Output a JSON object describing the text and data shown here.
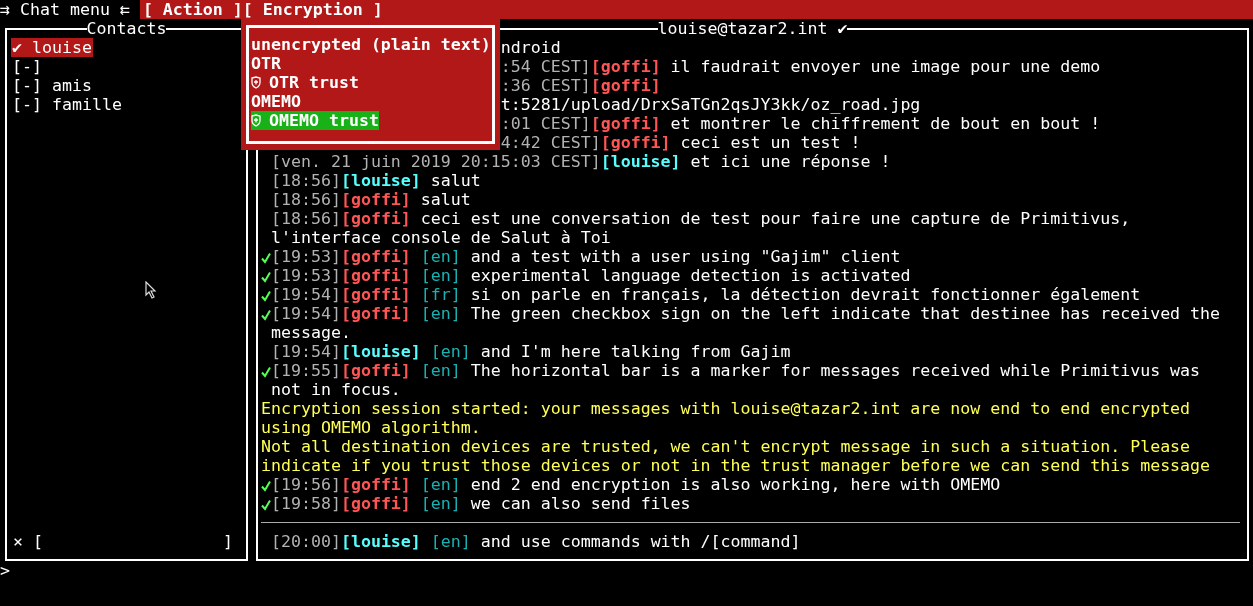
{
  "menu_bar": {
    "title": "⇉ Chat menu ⇇",
    "items": [
      {
        "label": "[ Action ]"
      },
      {
        "label": "[ Encryption ]"
      }
    ]
  },
  "encryption_menu": {
    "items": [
      {
        "label": "unencrypted (plain text)",
        "kind": "plain",
        "selected": false
      },
      {
        "label": "OTR",
        "kind": "plain",
        "selected": false
      },
      {
        "label": "OTR trust",
        "kind": "trust",
        "selected": false
      },
      {
        "label": "OMEMO",
        "kind": "plain",
        "selected": false
      },
      {
        "label": "OMEMO trust",
        "kind": "trust",
        "selected": true
      }
    ]
  },
  "contacts": {
    "title": "Contacts",
    "items": [
      {
        "label": "✔ louise",
        "selected": true
      },
      {
        "label": "[-]",
        "selected": false
      },
      {
        "label": "[-] amis",
        "selected": false
      },
      {
        "label": "[-] famille",
        "selected": false
      }
    ],
    "filter": {
      "clear": "×",
      "open": "[",
      "close": "]"
    }
  },
  "chat": {
    "title": "louise@tazar2.int ✔",
    "lines": [
      {
        "kind": "continuation",
        "covered": true,
        "text": "ndroid"
      },
      {
        "kind": "message",
        "covered": true,
        "time": ":54 CEST]",
        "nick": "[goffi]",
        "color": "#ff5555",
        "text": "il faudrait envoyer une image pour une demo"
      },
      {
        "kind": "message",
        "covered": true,
        "time": ":36 CEST]",
        "nick": "[goffi]",
        "color": "#ff5555"
      },
      {
        "kind": "continuation",
        "covered": true,
        "text": "t:5281/upload/DrxSaTGn2qsJY3kk/oz_road.jpg"
      },
      {
        "kind": "message",
        "covered": true,
        "time": ":01 CEST]",
        "nick": "[goffi]",
        "color": "#ff5555",
        "text": "et montrer le chiffrement de bout en bout !"
      },
      {
        "kind": "message",
        "covered": true,
        "time": "4:42 CEST]",
        "nick": "[goffi]",
        "color": "#ff5555",
        "text": "ceci est un test !"
      },
      {
        "kind": "message",
        "received": false,
        "time": "[ven. 21 juin 2019 20:15:03 CEST]",
        "nick": "[louise]",
        "color": "#55ffff",
        "text": "et ici une réponse !"
      },
      {
        "kind": "message",
        "received": false,
        "time": "[18:56]",
        "nick": "[louise]",
        "color": "#55ffff",
        "text": "salut"
      },
      {
        "kind": "message",
        "received": false,
        "time": "[18:56]",
        "nick": "[goffi]",
        "color": "#ff5555",
        "text": "salut"
      },
      {
        "kind": "message",
        "received": false,
        "time": "[18:56]",
        "nick": "[goffi]",
        "color": "#ff5555",
        "text": "ceci est une conversation de test pour faire une capture de Primitivus, l'interface console de Salut à Toi"
      },
      {
        "kind": "message",
        "received": true,
        "time": "[19:53]",
        "nick": "[goffi]",
        "color": "#ff5555",
        "lang": "[en]",
        "text": "and a test with a user using \"Gajim\" client"
      },
      {
        "kind": "message",
        "received": true,
        "time": "[19:53]",
        "nick": "[goffi]",
        "color": "#ff5555",
        "lang": "[en]",
        "text": "experimental language detection is activated"
      },
      {
        "kind": "message",
        "received": true,
        "time": "[19:54]",
        "nick": "[goffi]",
        "color": "#ff5555",
        "lang": "[fr]",
        "text": "si on parle en français, la détection devrait fonctionner également"
      },
      {
        "kind": "message",
        "received": true,
        "time": "[19:54]",
        "nick": "[goffi]",
        "color": "#ff5555",
        "lang": "[en]",
        "text": "The green checkbox sign on the left indicate that destinee has received the message."
      },
      {
        "kind": "message",
        "received": false,
        "time": "[19:54]",
        "nick": "[louise]",
        "color": "#55ffff",
        "lang": "[en]",
        "text": "and I'm here talking from Gajim"
      },
      {
        "kind": "message",
        "received": true,
        "time": "[19:55]",
        "nick": "[goffi]",
        "color": "#ff5555",
        "lang": "[en]",
        "text": "The horizontal bar is a marker for messages received while Primitivus was not in focus."
      },
      {
        "kind": "info",
        "text": "Encryption session started: your messages with louise@tazar2.int are now end to end encrypted using OMEMO algorithm."
      },
      {
        "kind": "info",
        "text": "Not all destination devices are trusted, we can't encrypt message in such a situation. Please indicate if you trust those devices or not in the trust manager before we can send this message"
      },
      {
        "kind": "message",
        "received": true,
        "time": "[19:56]",
        "nick": "[goffi]",
        "color": "#ff5555",
        "lang": "[en]",
        "text": "end 2 end encryption is also working, here with OMEMO"
      },
      {
        "kind": "message",
        "received": true,
        "time": "[19:58]",
        "nick": "[goffi]",
        "color": "#ff5555",
        "lang": "[en]",
        "text": "we can also send files"
      },
      {
        "kind": "marker"
      },
      {
        "kind": "message",
        "received": false,
        "time": "[20:00]",
        "nick": "[louise]",
        "color": "#55ffff",
        "lang": "[en]",
        "text": "and use commands with /[command]"
      }
    ]
  },
  "prompt": ">"
}
